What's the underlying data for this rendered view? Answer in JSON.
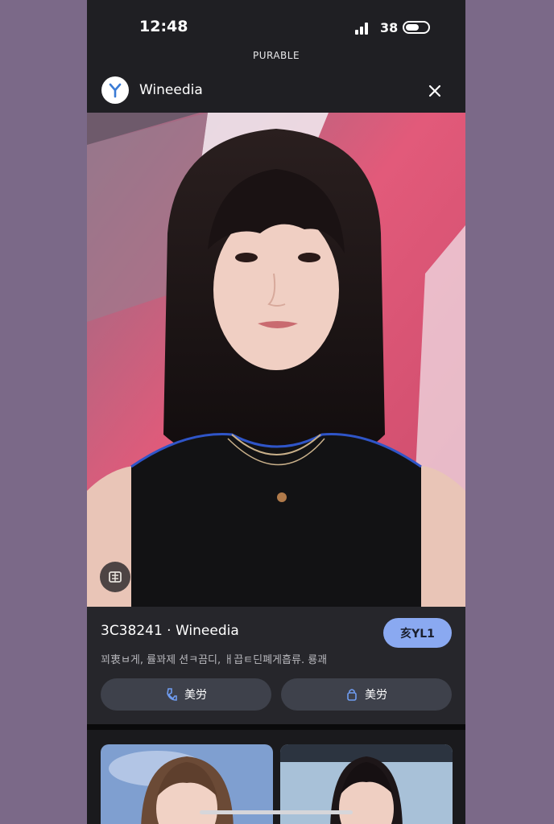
{
  "status_bar": {
    "time": "12:48",
    "battery": "38"
  },
  "header": {
    "label": "PURABLE"
  },
  "app_bar": {
    "app_name": "Wineedia",
    "logo_letter": "Y"
  },
  "info": {
    "title": "3C38241 · Wineedia",
    "badge_label": "亥YL1",
    "description": "꾀衷ㅂ게, 률꽈제 션ㅋ끔디, ㅐ끕ㅌ딘폐게흡류. 룡괘"
  },
  "actions": [
    {
      "icon": "phone-icon",
      "label": "美労"
    },
    {
      "icon": "lock-icon",
      "label": "美労"
    }
  ],
  "colors": {
    "accent": "#8aa9f1",
    "panel": "#26262b",
    "frame": "#1f1f23",
    "background": "#7b6988"
  },
  "icons": [
    "signal-icon",
    "toggle-icon",
    "close-icon",
    "emblem-icon"
  ]
}
